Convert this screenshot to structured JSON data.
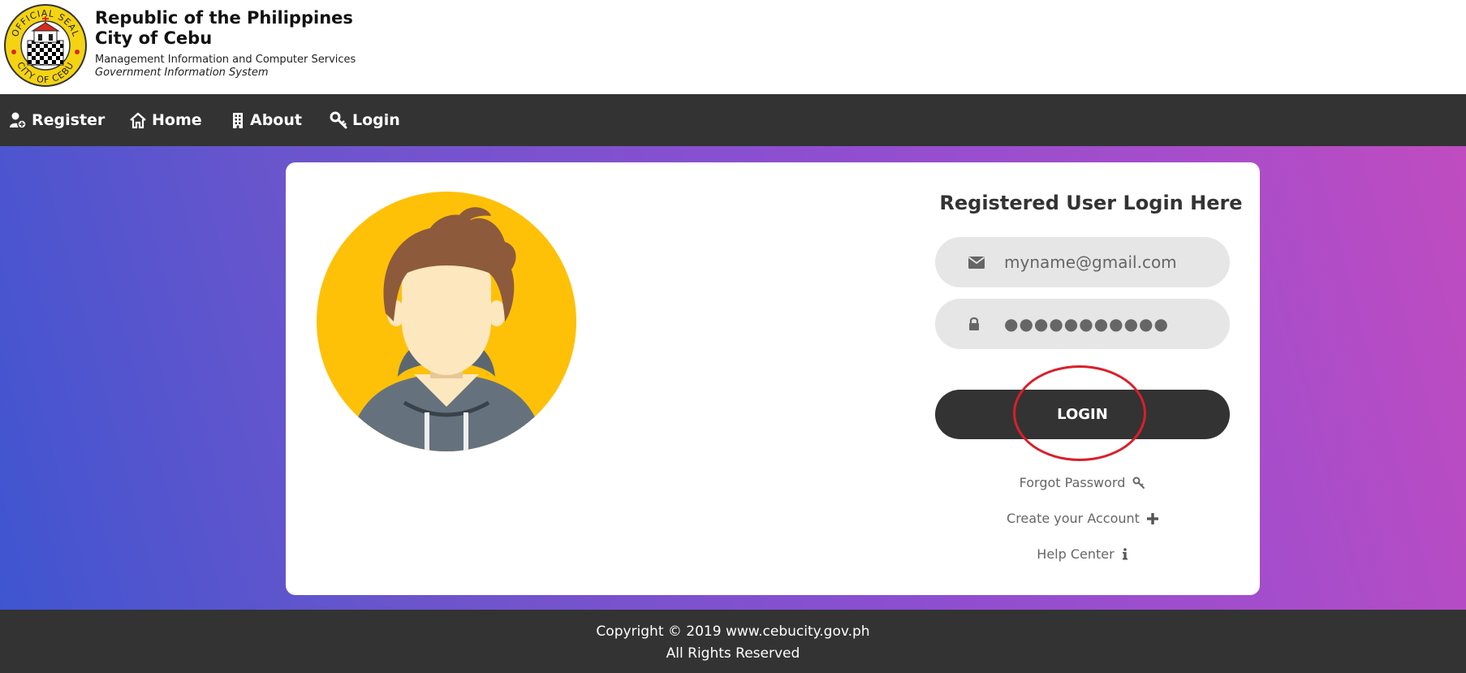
{
  "header": {
    "title_line1": "Republic of the Philippines",
    "title_line2": "City of Cebu",
    "subtitle_line1": "Management Information and Computer Services",
    "subtitle_line2": "Government Information System",
    "seal_text_top": "OFFICIAL SEAL",
    "seal_text_bottom": "CITY OF CEBU"
  },
  "nav": {
    "items": [
      {
        "label": "Register",
        "icon": "user-plus-icon"
      },
      {
        "label": "Home",
        "icon": "home-icon"
      },
      {
        "label": "About",
        "icon": "building-icon"
      },
      {
        "label": "Login",
        "icon": "key-icon"
      }
    ]
  },
  "login": {
    "title": "Registered User Login Here",
    "email_value": "myname@gmail.com",
    "email_icon": "envelope-icon",
    "password_masked": "●●●●●●●●●●●",
    "password_icon": "lock-icon",
    "button_label": "LOGIN",
    "forgot_label": "Forgot Password",
    "create_label": "Create your Account",
    "help_label": "Help Center"
  },
  "footer": {
    "line1": "Copyright © 2019 www.cebucity.gov.ph",
    "line2": "All Rights Reserved"
  },
  "colors": {
    "nav_bg": "#333333",
    "gradient_start": "#3f55d0",
    "gradient_end": "#c04cc0",
    "highlight": "#d8202a"
  }
}
